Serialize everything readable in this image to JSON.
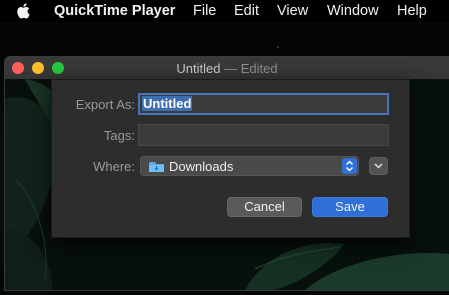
{
  "menubar": {
    "app_name": "QuickTime Player",
    "items": [
      "File",
      "Edit",
      "View",
      "Window",
      "Help"
    ]
  },
  "window": {
    "title_name": "Untitled",
    "title_suffix": " — Edited"
  },
  "export_sheet": {
    "export_as_label": "Export As:",
    "export_as_value": "Untitled",
    "tags_label": "Tags:",
    "tags_value": "",
    "where_label": "Where:",
    "where_value": "Downloads",
    "cancel_label": "Cancel",
    "save_label": "Save"
  },
  "colors": {
    "accent": "#2f6fd6",
    "selection": "#3d6fb0",
    "sheet_bg": "#2d2d2d"
  }
}
